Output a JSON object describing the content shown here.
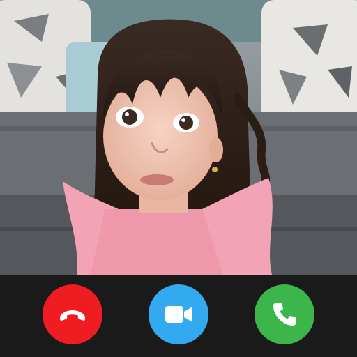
{
  "call": {
    "buttons": [
      {
        "id": "decline",
        "icon": "phone-hangup-icon",
        "color": "#ef1d22"
      },
      {
        "id": "video",
        "icon": "video-camera-icon",
        "color": "#33a9f0"
      },
      {
        "id": "accept",
        "icon": "phone-icon",
        "color": "#3cb54a"
      }
    ]
  },
  "colors": {
    "bar_background": "#1a1a1a",
    "icon_color": "#ffffff"
  }
}
